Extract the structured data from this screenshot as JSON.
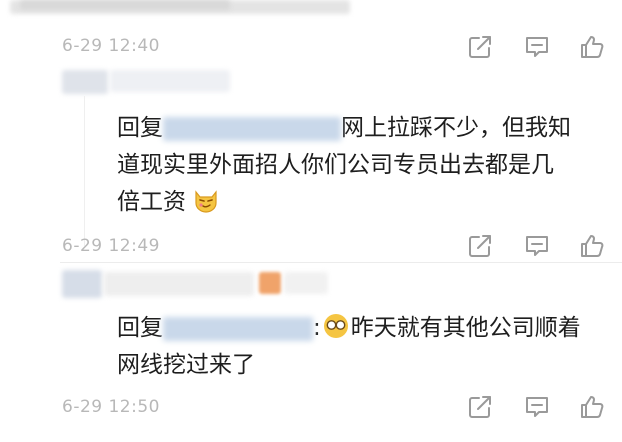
{
  "comments": [
    {
      "timestamp": "6-29 12:40"
    },
    {
      "prefix": "回复",
      "line1_after_mention": "网上拉踩不少，但我知",
      "line2": "道现实里外面招人你们公司专员出去都是几",
      "line3": "倍工资",
      "emoji": "smirk-cat-emoji",
      "timestamp": "6-29 12:49"
    },
    {
      "prefix": "回复",
      "line1_after_mention": ":",
      "line1_after_emoji": "昨天就有其他公司顺着",
      "line2": "网线挖过来了",
      "emoji": "infinity-glasses-emoji",
      "timestamp": "6-29 12:50"
    }
  ],
  "actions": [
    "share-icon",
    "comment-icon",
    "like-icon"
  ],
  "colors": {
    "timestamp": "#b8b8b8",
    "text": "#1e1e1e",
    "icon": "#9a9a9a",
    "blur_blue": "#c9d8ea",
    "blur_orange": "#f0a36a",
    "emoji_yellow": "#f5c542"
  }
}
